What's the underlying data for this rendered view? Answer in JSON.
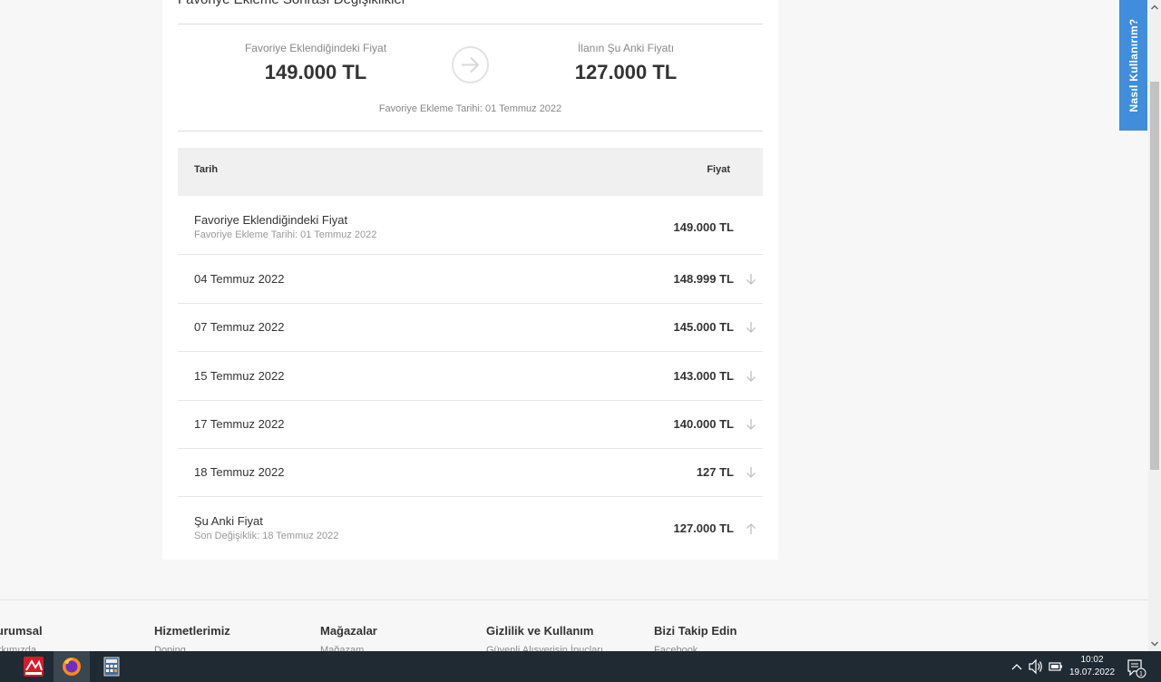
{
  "section_title": "Favoriye Ekleme Sonrası Değişiklikler",
  "comparison": {
    "left_label": "Favoriye Eklendiğindeki Fiyat",
    "left_value": "149.000 TL",
    "right_label": "İlanın Şu Anki Fiyatı",
    "right_value": "127.000 TL",
    "date_line": "Favoriye Ekleme Tarihi: 01 Temmuz 2022"
  },
  "table": {
    "col_date": "Tarih",
    "col_price": "Fiyat",
    "rows": [
      {
        "date": "Favoriye Eklendiğindeki Fiyat",
        "sub": "Favoriye Ekleme Tarihi: 01 Temmuz 2022",
        "price": "149.000 TL",
        "trend": "none"
      },
      {
        "date": "04 Temmuz 2022",
        "sub": "",
        "price": "148.999 TL",
        "trend": "down"
      },
      {
        "date": "07 Temmuz 2022",
        "sub": "",
        "price": "145.000 TL",
        "trend": "down"
      },
      {
        "date": "15 Temmuz 2022",
        "sub": "",
        "price": "143.000 TL",
        "trend": "down"
      },
      {
        "date": "17 Temmuz 2022",
        "sub": "",
        "price": "140.000 TL",
        "trend": "down"
      },
      {
        "date": "18 Temmuz 2022",
        "sub": "",
        "price": "127 TL",
        "trend": "down"
      },
      {
        "date": "Şu Anki Fiyat",
        "sub": "Son Değişiklik: 18 Temmuz 2022",
        "price": "127.000 TL",
        "trend": "up"
      }
    ]
  },
  "footer": {
    "columns": [
      {
        "heading": "urumsal",
        "link": "kkımızda"
      },
      {
        "heading": "Hizmetlerimiz",
        "link": "Doping"
      },
      {
        "heading": "Mağazalar",
        "link": "Mağazam"
      },
      {
        "heading": "Gizlilik ve Kullanım",
        "link": "Güvenli Alışverişin İpuçları"
      },
      {
        "heading": "Bizi Takip Edin",
        "link": "Facebook"
      }
    ]
  },
  "help_tab": "Nasıl Kullanırım?",
  "taskbar": {
    "time": "10:02",
    "date": "19.07.2022",
    "notification_count": "1",
    "apps": [
      "app-icon",
      "firefox-icon",
      "calculator-icon"
    ]
  },
  "colors": {
    "accent": "#3f8ddb",
    "taskbar": "#1f2a33"
  }
}
